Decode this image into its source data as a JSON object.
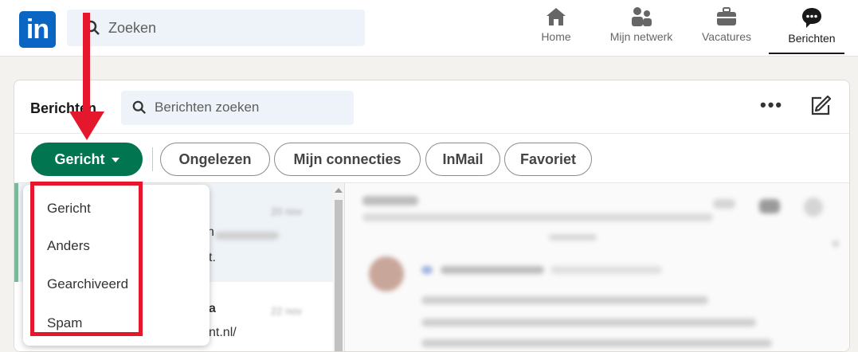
{
  "nav": {
    "search_placeholder": "Zoeken",
    "items": [
      {
        "label": "Home",
        "icon": "home-icon"
      },
      {
        "label": "Mijn netwerk",
        "icon": "network-icon"
      },
      {
        "label": "Vacatures",
        "icon": "briefcase-icon"
      },
      {
        "label": "Berichten",
        "icon": "messaging-icon"
      }
    ]
  },
  "messaging": {
    "title": "Berichten",
    "search_placeholder": "Berichten zoeken",
    "filters": {
      "primary": "Gericht",
      "pills": [
        "Ongelezen",
        "Mijn connecties",
        "InMail",
        "Favoriet"
      ]
    },
    "dropdown": [
      "Gericht",
      "Anders",
      "Gearchiveerd",
      "Spam"
    ],
    "list_snippets": [
      "n",
      "t.",
      "a",
      "nt.nl/"
    ]
  },
  "colors": {
    "brand": "#0a66c2",
    "primary_pill": "#01754f",
    "annotation": "#e5172d"
  }
}
